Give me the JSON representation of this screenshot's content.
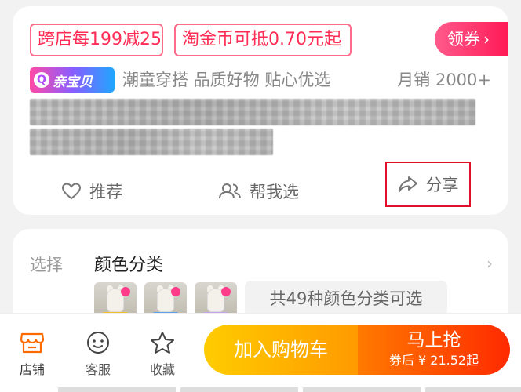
{
  "coupons": {
    "cross_store": "跨店每199减25",
    "taojinbi": "淘金币可抵0.70元起",
    "claim_label": "领券",
    "claim_chevron": "›"
  },
  "product": {
    "badge_label": "亲宝贝",
    "badge_icon": "Q",
    "tagline": "潮童穿搭 品质好物 贴心优选",
    "monthly_sales": "月销  2000+"
  },
  "actions": {
    "recommend": "推荐",
    "help_choose": "帮我选",
    "share": "分享"
  },
  "selection": {
    "label": "选择",
    "title": "颜色分类",
    "chevron": "›",
    "variants_text": "共49种颜色分类可选"
  },
  "bottom_bar": {
    "store": "店铺",
    "service": "客服",
    "favorite": "收藏",
    "add_to_cart": "加入购物车",
    "buy_now": "马上抢",
    "after_coupon_price": "券后 ¥ 21.52起"
  },
  "colors": {
    "accent_red": "#ff2d55",
    "share_highlight": "#e0102a",
    "cart_yellow": "#ffb400",
    "buy_orange": "#ff4a00"
  }
}
